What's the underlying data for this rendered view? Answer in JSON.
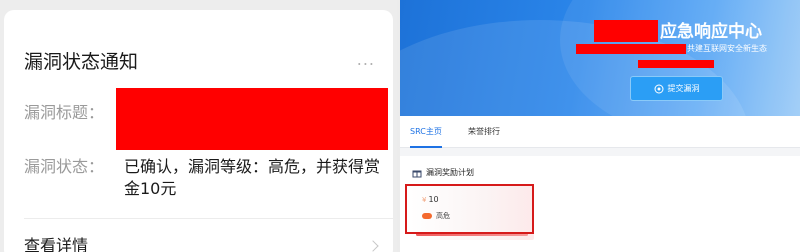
{
  "notification": {
    "title": "漏洞状态通知",
    "more_icon": "...",
    "title_label": "漏洞标题：",
    "status_label": "漏洞状态：",
    "status_value": "已确认，漏洞等级：高危，并获得赏金10元",
    "details_link": "查看详情"
  },
  "src_site": {
    "banner_heading": "应急响应中心",
    "banner_slogan": "共建互联网安全新生态",
    "submit_button": "提交漏洞",
    "tabs": [
      {
        "label": "SRC主页",
        "active": true
      },
      {
        "label": "荣誉排行",
        "active": false
      }
    ],
    "section_title": "漏洞奖励计划",
    "reward": {
      "amount_symbol": "¥",
      "amount": "10",
      "level": "高危"
    }
  },
  "colors": {
    "redaction": "#ff0000",
    "highlight_border": "#d61a1a",
    "accent_blue": "#1e72e4",
    "level_high": "#f46a2e"
  }
}
